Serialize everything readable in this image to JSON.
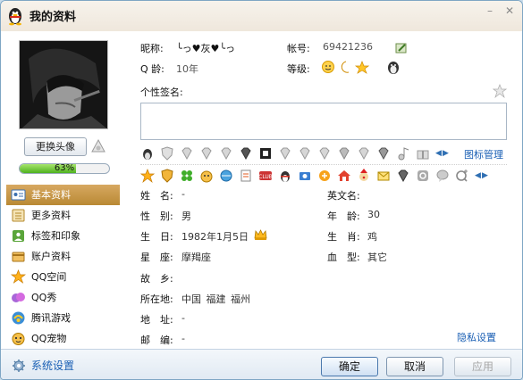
{
  "window": {
    "title": "我的资料",
    "min_label": "–",
    "close_label": "✕"
  },
  "profile": {
    "nickname_label": "昵称:",
    "nickname_value": "╰っ♥灰♥╰っ",
    "account_label": "帐号:",
    "account_value": "69421236",
    "age_label": "Q 龄:",
    "age_value": "10年",
    "level_label": "等级:",
    "signature_label": "个性签名:",
    "signature_value": ""
  },
  "sidebar": {
    "change_avatar": "更换头像",
    "progress_text": "63%",
    "progress_fraction": 0.63,
    "items": [
      {
        "label": "基本资料",
        "icon": "id-card-icon",
        "active": true
      },
      {
        "label": "更多资料",
        "icon": "list-icon",
        "active": false
      },
      {
        "label": "标签和印象",
        "icon": "tag-icon",
        "active": false
      },
      {
        "label": "账户资料",
        "icon": "account-icon",
        "active": false
      },
      {
        "label": "QQ空间",
        "icon": "star-icon",
        "active": false
      },
      {
        "label": "QQ秀",
        "icon": "qqshow-icon",
        "active": false
      },
      {
        "label": "腾讯游戏",
        "icon": "game-icon",
        "active": false
      },
      {
        "label": "QQ宠物",
        "icon": "pet-icon",
        "active": false
      }
    ]
  },
  "icon_manage": "图标管理",
  "details": {
    "name_label": "姓　名:",
    "name_value": "-",
    "en_name_label": "英文名:",
    "en_name_value": "",
    "gender_label": "性　别:",
    "gender_value": "男",
    "age2_label": "年　龄:",
    "age2_value": "30",
    "birthday_label": "生　日:",
    "birthday_value": "1982年1月5日",
    "zodiac_label": "生　肖:",
    "zodiac_value": "鸡",
    "star_label": "星　座:",
    "star_value": "摩羯座",
    "blood_label": "血　型:",
    "blood_value": "其它",
    "hometown_label": "故　乡:",
    "hometown_value": "",
    "location_label": "所在地:",
    "location_value": "中国  福建  福州",
    "address_label": "地　址:",
    "address_value": "-",
    "postcode_label": "邮　编:",
    "postcode_value": "-",
    "privacy_link": "隐私设置"
  },
  "footer": {
    "settings_label": "系统设置",
    "ok_label": "确定",
    "cancel_label": "取消",
    "apply_label": "应用"
  },
  "colors": {
    "accent": "#1a5fb4",
    "active_nav": "#c49541",
    "progress": "#5fbf2a"
  }
}
